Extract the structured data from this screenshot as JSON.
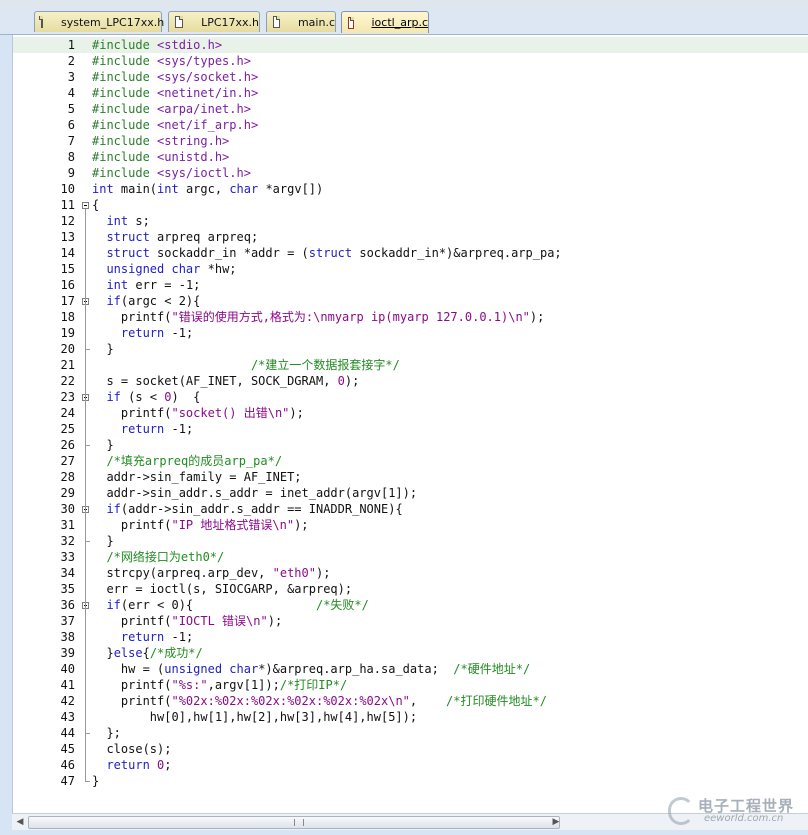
{
  "tabs": [
    {
      "label": "system_LPC17xx.h",
      "active": false
    },
    {
      "label": "LPC17xx.h",
      "active": false
    },
    {
      "label": "main.c",
      "active": false
    },
    {
      "label": "ioctl_arp.c",
      "active": true
    }
  ],
  "code_lines": [
    [
      {
        "t": "pre",
        "v": "#include "
      },
      {
        "t": "inc",
        "v": "<stdio.h>"
      }
    ],
    [
      {
        "t": "pre",
        "v": "#include "
      },
      {
        "t": "inc",
        "v": "<sys/types.h>"
      }
    ],
    [
      {
        "t": "pre",
        "v": "#include "
      },
      {
        "t": "inc",
        "v": "<sys/socket.h>"
      }
    ],
    [
      {
        "t": "pre",
        "v": "#include "
      },
      {
        "t": "inc",
        "v": "<netinet/in.h>"
      }
    ],
    [
      {
        "t": "pre",
        "v": "#include "
      },
      {
        "t": "inc",
        "v": "<arpa/inet.h>"
      }
    ],
    [
      {
        "t": "pre",
        "v": "#include "
      },
      {
        "t": "inc",
        "v": "<net/if_arp.h>"
      }
    ],
    [
      {
        "t": "pre",
        "v": "#include "
      },
      {
        "t": "inc",
        "v": "<string.h>"
      }
    ],
    [
      {
        "t": "pre",
        "v": "#include "
      },
      {
        "t": "inc",
        "v": "<unistd.h>"
      }
    ],
    [
      {
        "t": "pre",
        "v": "#include "
      },
      {
        "t": "inc",
        "v": "<sys/ioctl.h>"
      }
    ],
    [
      {
        "t": "kw",
        "v": "int"
      },
      {
        "t": "n",
        "v": " main("
      },
      {
        "t": "kw",
        "v": "int"
      },
      {
        "t": "n",
        "v": " argc, "
      },
      {
        "t": "kw",
        "v": "char"
      },
      {
        "t": "n",
        "v": " *argv[])"
      }
    ],
    [
      {
        "t": "n",
        "v": "{"
      }
    ],
    [
      {
        "t": "n",
        "v": "  "
      },
      {
        "t": "kw",
        "v": "int"
      },
      {
        "t": "n",
        "v": " s;"
      }
    ],
    [
      {
        "t": "n",
        "v": "  "
      },
      {
        "t": "kw",
        "v": "struct"
      },
      {
        "t": "n",
        "v": " arpreq arpreq;"
      }
    ],
    [
      {
        "t": "n",
        "v": "  "
      },
      {
        "t": "kw",
        "v": "struct"
      },
      {
        "t": "n",
        "v": " sockaddr_in *addr = ("
      },
      {
        "t": "kw",
        "v": "struct"
      },
      {
        "t": "n",
        "v": " sockaddr_in*)&arpreq.arp_pa;"
      }
    ],
    [
      {
        "t": "n",
        "v": "  "
      },
      {
        "t": "kw",
        "v": "unsigned"
      },
      {
        "t": "n",
        "v": " "
      },
      {
        "t": "kw",
        "v": "char"
      },
      {
        "t": "n",
        "v": " *hw;"
      }
    ],
    [
      {
        "t": "n",
        "v": "  "
      },
      {
        "t": "kw",
        "v": "int"
      },
      {
        "t": "n",
        "v": " err = -1;"
      }
    ],
    [
      {
        "t": "n",
        "v": "  "
      },
      {
        "t": "kw",
        "v": "if"
      },
      {
        "t": "n",
        "v": "(argc < 2){"
      }
    ],
    [
      {
        "t": "n",
        "v": "    printf("
      },
      {
        "t": "str",
        "v": "\"错误的使用方式,格式为:\\nmyarp ip(myarp 127.0.0.1)\\n\""
      },
      {
        "t": "n",
        "v": ");"
      }
    ],
    [
      {
        "t": "n",
        "v": "    "
      },
      {
        "t": "kw",
        "v": "return"
      },
      {
        "t": "n",
        "v": " -1;"
      }
    ],
    [
      {
        "t": "n",
        "v": "  }"
      }
    ],
    [
      {
        "t": "n",
        "v": "                      "
      },
      {
        "t": "cm",
        "v": "/*建立一个数据报套接字*/"
      }
    ],
    [
      {
        "t": "n",
        "v": "  s = socket(AF_INET, SOCK_DGRAM, "
      },
      {
        "t": "num",
        "v": "0"
      },
      {
        "t": "n",
        "v": ");"
      }
    ],
    [
      {
        "t": "n",
        "v": "  "
      },
      {
        "t": "kw",
        "v": "if"
      },
      {
        "t": "n",
        "v": " (s < "
      },
      {
        "t": "num",
        "v": "0"
      },
      {
        "t": "n",
        "v": ")  {"
      }
    ],
    [
      {
        "t": "n",
        "v": "    printf("
      },
      {
        "t": "str",
        "v": "\"socket() 出错\\n\""
      },
      {
        "t": "n",
        "v": ");"
      }
    ],
    [
      {
        "t": "n",
        "v": "    "
      },
      {
        "t": "kw",
        "v": "return"
      },
      {
        "t": "n",
        "v": " -1;"
      }
    ],
    [
      {
        "t": "n",
        "v": "  }"
      }
    ],
    [
      {
        "t": "n",
        "v": "  "
      },
      {
        "t": "cm",
        "v": "/*填充arpreq的成员arp_pa*/"
      }
    ],
    [
      {
        "t": "n",
        "v": "  addr->sin_family = AF_INET;"
      }
    ],
    [
      {
        "t": "n",
        "v": "  addr->sin_addr.s_addr = inet_addr(argv[1]);"
      }
    ],
    [
      {
        "t": "n",
        "v": "  "
      },
      {
        "t": "kw",
        "v": "if"
      },
      {
        "t": "n",
        "v": "(addr->sin_addr.s_addr == INADDR_NONE){"
      }
    ],
    [
      {
        "t": "n",
        "v": "    printf("
      },
      {
        "t": "str",
        "v": "\"IP 地址格式错误\\n\""
      },
      {
        "t": "n",
        "v": ");"
      }
    ],
    [
      {
        "t": "n",
        "v": "  }"
      }
    ],
    [
      {
        "t": "n",
        "v": "  "
      },
      {
        "t": "cm",
        "v": "/*网络接口为eth0*/"
      }
    ],
    [
      {
        "t": "n",
        "v": "  strcpy(arpreq.arp_dev, "
      },
      {
        "t": "str",
        "v": "\"eth0\""
      },
      {
        "t": "n",
        "v": ");"
      }
    ],
    [
      {
        "t": "n",
        "v": "  err = ioctl(s, SIOCGARP, &arpreq);"
      }
    ],
    [
      {
        "t": "n",
        "v": "  "
      },
      {
        "t": "kw",
        "v": "if"
      },
      {
        "t": "n",
        "v": "(err < 0){                 "
      },
      {
        "t": "cm",
        "v": "/*失败*/"
      }
    ],
    [
      {
        "t": "n",
        "v": "    printf("
      },
      {
        "t": "str",
        "v": "\"IOCTL 错误\\n\""
      },
      {
        "t": "n",
        "v": ");"
      }
    ],
    [
      {
        "t": "n",
        "v": "    "
      },
      {
        "t": "kw",
        "v": "return"
      },
      {
        "t": "n",
        "v": " -1;"
      }
    ],
    [
      {
        "t": "n",
        "v": "  }"
      },
      {
        "t": "kw",
        "v": "else"
      },
      {
        "t": "n",
        "v": "{"
      },
      {
        "t": "cm",
        "v": "/*成功*/"
      }
    ],
    [
      {
        "t": "n",
        "v": "    hw = ("
      },
      {
        "t": "kw",
        "v": "unsigned"
      },
      {
        "t": "n",
        "v": " "
      },
      {
        "t": "kw",
        "v": "char"
      },
      {
        "t": "n",
        "v": "*)&arpreq.arp_ha.sa_data;  "
      },
      {
        "t": "cm",
        "v": "/*硬件地址*/"
      }
    ],
    [
      {
        "t": "n",
        "v": "    printf("
      },
      {
        "t": "str",
        "v": "\"%s:\""
      },
      {
        "t": "n",
        "v": ",argv[1]);"
      },
      {
        "t": "cm",
        "v": "/*打印IP*/"
      }
    ],
    [
      {
        "t": "n",
        "v": "    printf("
      },
      {
        "t": "str",
        "v": "\"%02x:%02x:%02x:%02x:%02x:%02x\\n\""
      },
      {
        "t": "n",
        "v": ",    "
      },
      {
        "t": "cm",
        "v": "/*打印硬件地址*/"
      }
    ],
    [
      {
        "t": "n",
        "v": "        hw[0],hw[1],hw[2],hw[3],hw[4],hw[5]);"
      }
    ],
    [
      {
        "t": "n",
        "v": "  };"
      }
    ],
    [
      {
        "t": "n",
        "v": "  close(s);"
      }
    ],
    [
      {
        "t": "n",
        "v": "  "
      },
      {
        "t": "kw",
        "v": "return"
      },
      {
        "t": "n",
        "v": " "
      },
      {
        "t": "num",
        "v": "0"
      },
      {
        "t": "n",
        "v": ";"
      }
    ],
    [
      {
        "t": "n",
        "v": "}"
      }
    ]
  ],
  "watermark": {
    "cn": "电子工程世界",
    "en": "eeworld.com.cn"
  },
  "colors": {
    "keyword": "#2020c8",
    "string": "#8b0a8b",
    "comment": "#228b22",
    "preprocessor": "#2e7d2e",
    "current_line": "#e8f2e8"
  },
  "icons": [
    "file-icon",
    "fold-minus-icon",
    "scroll-left-icon",
    "scroll-right-icon",
    "scroll-grip-icon",
    "watermark-logo-icon"
  ]
}
